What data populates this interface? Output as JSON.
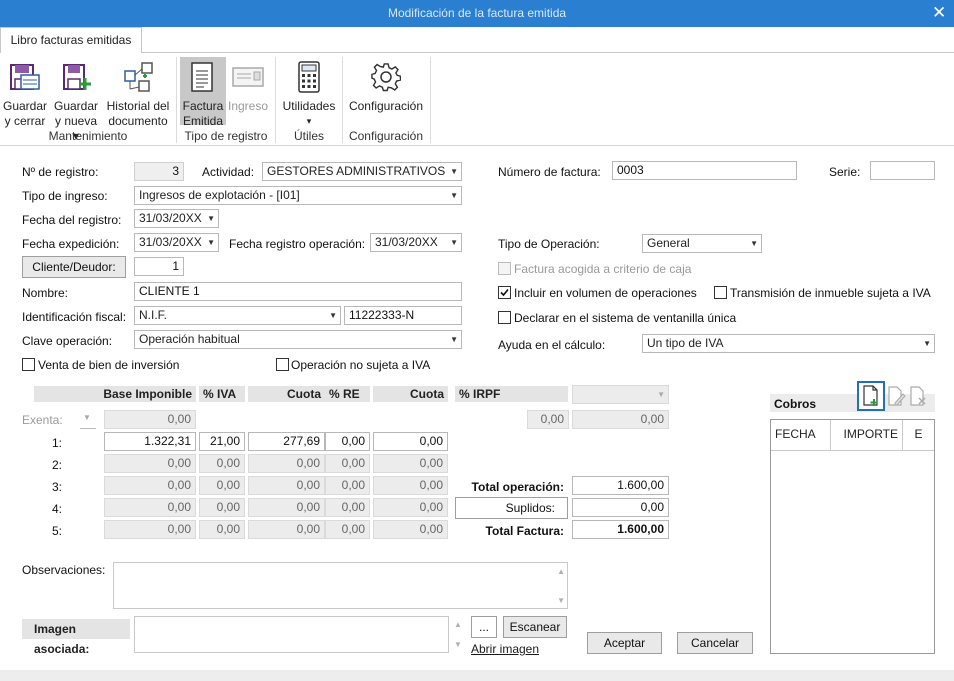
{
  "window": {
    "title": "Modificación de la factura emitida",
    "close_glyph": "✕"
  },
  "ribbon": {
    "tab": "Libro facturas emitidas",
    "buttons": {
      "guardar_cerrar": [
        "Guardar",
        "y cerrar"
      ],
      "guardar_nueva": [
        "Guardar",
        "y nueva ▾"
      ],
      "historial": [
        "Historial del",
        "documento"
      ],
      "factura_emitida": [
        "Factura",
        "Emitida"
      ],
      "ingreso": [
        "Ingreso"
      ],
      "utilidades": [
        "Utilidades",
        "▾"
      ],
      "configuracion": [
        "Configuración"
      ]
    },
    "groups": {
      "mantenimiento": "Mantenimiento",
      "tipo_registro": "Tipo de registro",
      "utiles": "Útiles",
      "configuracion": "Configuración"
    }
  },
  "form": {
    "num_registro_label": "Nº de registro:",
    "num_registro": "3",
    "actividad_label": "Actividad:",
    "actividad": "GESTORES ADMINISTRATIVOS",
    "tipo_ingreso_label": "Tipo de ingreso:",
    "tipo_ingreso": "Ingresos de explotación - [I01]",
    "fecha_registro_label": "Fecha del registro:",
    "fecha_registro": "31/03/20XX",
    "fecha_expedicion_label": "Fecha expedición:",
    "fecha_expedicion": "31/03/20XX",
    "fecha_reg_op_label": "Fecha registro operación:",
    "fecha_reg_op": "31/03/20XX",
    "cliente_button": "Cliente/Deudor:",
    "cliente_num": "1",
    "nombre_label": "Nombre:",
    "nombre": "CLIENTE 1",
    "id_fiscal_label": "Identificación fiscal:",
    "id_fiscal_tipo": "N.I.F.",
    "id_fiscal": "11222333-N",
    "clave_label": "Clave operación:",
    "clave": "Operación habitual",
    "venta_bien_label": "Venta de bien de inversión",
    "op_no_sujeta_label": "Operación no sujeta a IVA",
    "num_factura_label": "Número de factura:",
    "num_factura": "0003",
    "serie_label": "Serie:",
    "serie": "",
    "tipo_op_label": "Tipo de Operación:",
    "tipo_op": "General",
    "criterio_caja_label": "Factura acogida a criterio de caja",
    "incluir_vol_label": "Incluir en  volumen de operaciones",
    "transmision_label": "Transmisión de inmueble sujeta a IVA",
    "ventanilla_label": "Declarar en el sistema de ventanilla única",
    "ayuda_label": "Ayuda en el cálculo:",
    "ayuda": "Un tipo de IVA",
    "checks": {
      "venta_bien": false,
      "op_no_sujeta": false,
      "criterio_caja": false,
      "incluir_vol": true,
      "transmision": false,
      "ventanilla": false
    }
  },
  "table": {
    "headers": {
      "base": "Base Imponible",
      "iva": "% IVA",
      "cuota": "Cuota",
      "re": "% RE",
      "cuota_re": "Cuota",
      "irpf": "% IRPF"
    },
    "exenta_label": "Exenta:",
    "exenta_value": "0,00",
    "rows": [
      {
        "label": "1:",
        "base": "1.322,31",
        "iva": "21,00",
        "cuota": "277,69",
        "re": "0,00",
        "cuota_re": "0,00"
      },
      {
        "label": "2:",
        "base": "0,00",
        "iva": "0,00",
        "cuota": "0,00",
        "re": "0,00",
        "cuota_re": "0,00"
      },
      {
        "label": "3:",
        "base": "0,00",
        "iva": "0,00",
        "cuota": "0,00",
        "re": "0,00",
        "cuota_re": "0,00"
      },
      {
        "label": "4:",
        "base": "0,00",
        "iva": "0,00",
        "cuota": "0,00",
        "re": "0,00",
        "cuota_re": "0,00"
      },
      {
        "label": "5:",
        "base": "0,00",
        "iva": "0,00",
        "cuota": "0,00",
        "re": "0,00",
        "cuota_re": "0,00"
      }
    ],
    "irpf_pct": "0,00",
    "irpf_value": "0,00",
    "total_operacion_label": "Total operación:",
    "total_operacion": "1.600,00",
    "suplidos_label": "Suplidos:",
    "suplidos": "0,00",
    "total_factura_label": "Total Factura:",
    "total_factura": "1.600,00"
  },
  "cobros": {
    "title": "Cobros",
    "columns": [
      "FECHA",
      "IMPORTE",
      "E"
    ]
  },
  "observaciones_label": "Observaciones:",
  "imagen": {
    "label": "Imagen asociada:",
    "browse": "...",
    "escanear": "Escanear",
    "abrir": "Abrir imagen"
  },
  "actions": {
    "aceptar": "Aceptar",
    "cancelar": "Cancelar"
  }
}
